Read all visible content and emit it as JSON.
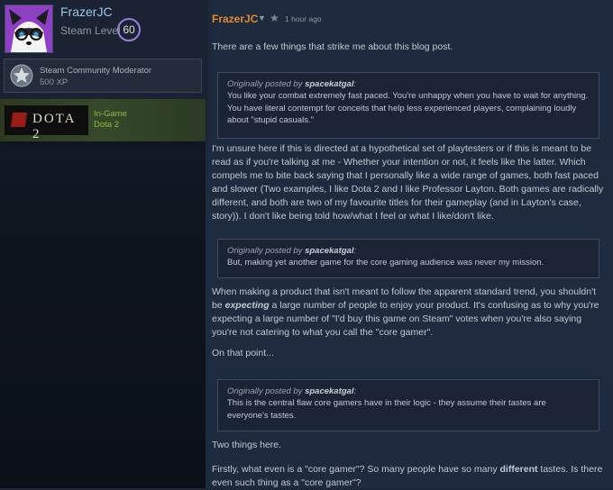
{
  "profile": {
    "name": "FrazerJC",
    "level_label": "Steam Level",
    "level": "60",
    "badge": {
      "title": "Steam Community Moderator",
      "xp": "500 XP",
      "icon": "star-badge-icon"
    },
    "game": {
      "logo": "DOTA 2",
      "status": "In-Game",
      "name": "Dota 2"
    }
  },
  "post": {
    "author": "FrazerJC",
    "time": "1 hour ago",
    "icons": [
      "chevron-down-icon",
      "star-icon"
    ],
    "paragraphs": [
      "There are a few things that strike me about this blog post.",
      "I'm unsure here if this is directed at a hypothetical set of playtesters or if this is meant to be read as if you're talking at me - Whether your intention or not, it feels like the latter. Which compels me to bite back saying that I personally like a wide range of games, both fast paced and slower (Two examples, I like Dota 2 and I like Professor Layton. Both games are radically different, and both are two of my favourite titles for their gameplay (and in Layton's case, story)). I don't like being told how/what I feel or what I like/don't like.",
      "When making a product that isn't meant to follow the apparent standard trend, you shouldn't be",
      "expecting",
      "a large number of people to enjoy your product. It's confusing as to why you're expecting a large number of \"I'd buy this game on Steam\" votes when you're also saying you're not catering to what you call the \"core gamer\".",
      "On that point...",
      "Two things here.",
      "Firstly, what even is a \"core gamer\"? So many people have so many",
      "different",
      "tastes. Is there even such thing as a \"core gamer\"?"
    ],
    "quotes": [
      {
        "prefix": "Originally posted by",
        "author": "spacekatgal",
        "text": "You like your combat extremely fast paced. You're unhappy when you have to wait for anything. You have literal contempt for conceits that help less experienced players, complaining loudly about \"stupid casuals.\""
      },
      {
        "prefix": "Originally posted by",
        "author": "spacekatgal",
        "text": "But, making yet another game for the core gaming audience was never my mission."
      },
      {
        "prefix": "Originally posted by",
        "author": "spacekatgal",
        "text": "This is the central flaw core gamers have in their logic - they assume their tastes are everyone's tastes."
      }
    ]
  }
}
